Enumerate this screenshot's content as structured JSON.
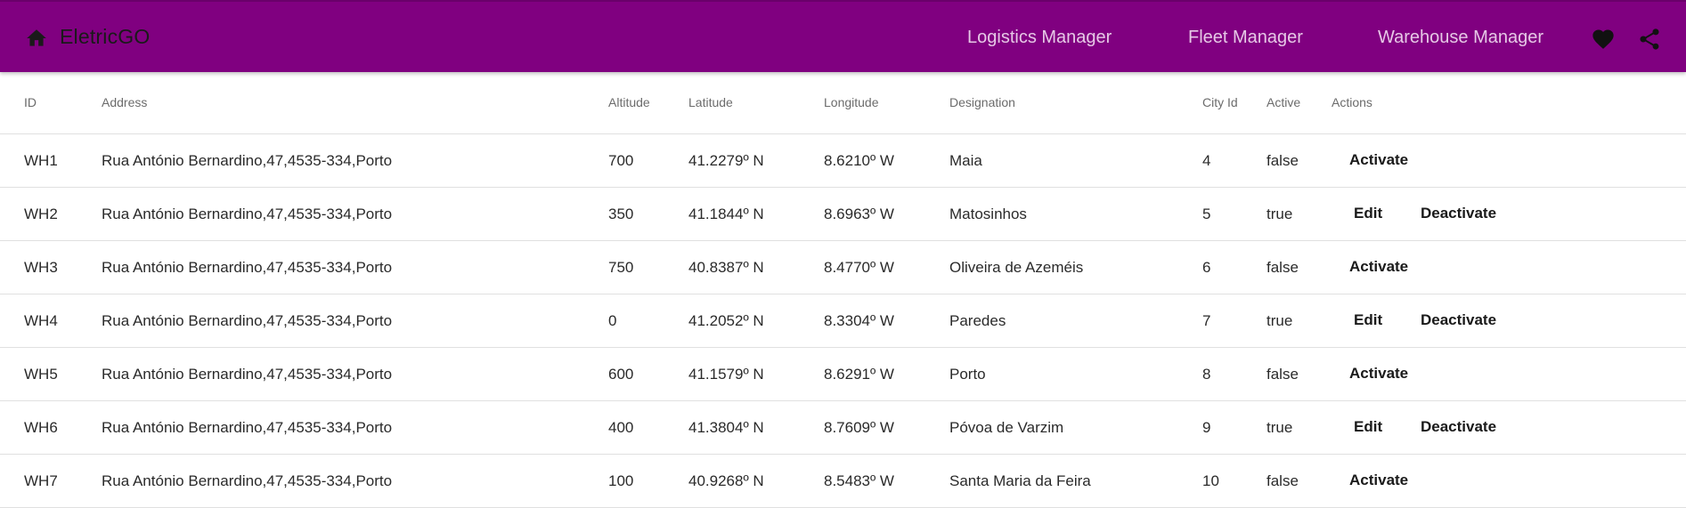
{
  "header": {
    "title": "EletricGO",
    "home_icon": "home-icon",
    "nav": [
      {
        "label": "Logistics Manager"
      },
      {
        "label": "Fleet Manager"
      },
      {
        "label": "Warehouse Manager"
      }
    ],
    "heart_icon": "heart-icon",
    "share_icon": "share-icon",
    "colors": {
      "toolbar": "#800080",
      "nav_text": "#e6c8e6",
      "title_text": "#1a1a1a"
    }
  },
  "table": {
    "columns": {
      "id": "ID",
      "address": "Address",
      "altitude": "Altitude",
      "latitude": "Latitude",
      "longitude": "Longitude",
      "designation": "Designation",
      "city": "City Id",
      "active": "Active",
      "actions": "Actions"
    },
    "actions": {
      "activate": "Activate",
      "edit": "Edit",
      "deactivate": "Deactivate"
    },
    "rows": [
      {
        "id": "WH1",
        "address": "Rua António Bernardino,47,4535-334,Porto",
        "altitude": "700",
        "latitude": "41.2279º N",
        "longitude": "8.6210º W",
        "designation": "Maia",
        "city": "4",
        "active": "false"
      },
      {
        "id": "WH2",
        "address": "Rua António Bernardino,47,4535-334,Porto",
        "altitude": "350",
        "latitude": "41.1844º N",
        "longitude": "8.6963º W",
        "designation": "Matosinhos",
        "city": "5",
        "active": "true"
      },
      {
        "id": "WH3",
        "address": "Rua António Bernardino,47,4535-334,Porto",
        "altitude": "750",
        "latitude": "40.8387º N",
        "longitude": "8.4770º W",
        "designation": "Oliveira de Azeméis",
        "city": "6",
        "active": "false"
      },
      {
        "id": "WH4",
        "address": "Rua António Bernardino,47,4535-334,Porto",
        "altitude": "0",
        "latitude": "41.2052º N",
        "longitude": "8.3304º W",
        "designation": "Paredes",
        "city": "7",
        "active": "true"
      },
      {
        "id": "WH5",
        "address": "Rua António Bernardino,47,4535-334,Porto",
        "altitude": "600",
        "latitude": "41.1579º N",
        "longitude": "8.6291º W",
        "designation": "Porto",
        "city": "8",
        "active": "false"
      },
      {
        "id": "WH6",
        "address": "Rua António Bernardino,47,4535-334,Porto",
        "altitude": "400",
        "latitude": "41.3804º N",
        "longitude": "8.7609º W",
        "designation": "Póvoa de Varzim",
        "city": "9",
        "active": "true"
      },
      {
        "id": "WH7",
        "address": "Rua António Bernardino,47,4535-334,Porto",
        "altitude": "100",
        "latitude": "40.9268º N",
        "longitude": "8.5483º W",
        "designation": "Santa Maria da Feira",
        "city": "10",
        "active": "false"
      }
    ]
  }
}
